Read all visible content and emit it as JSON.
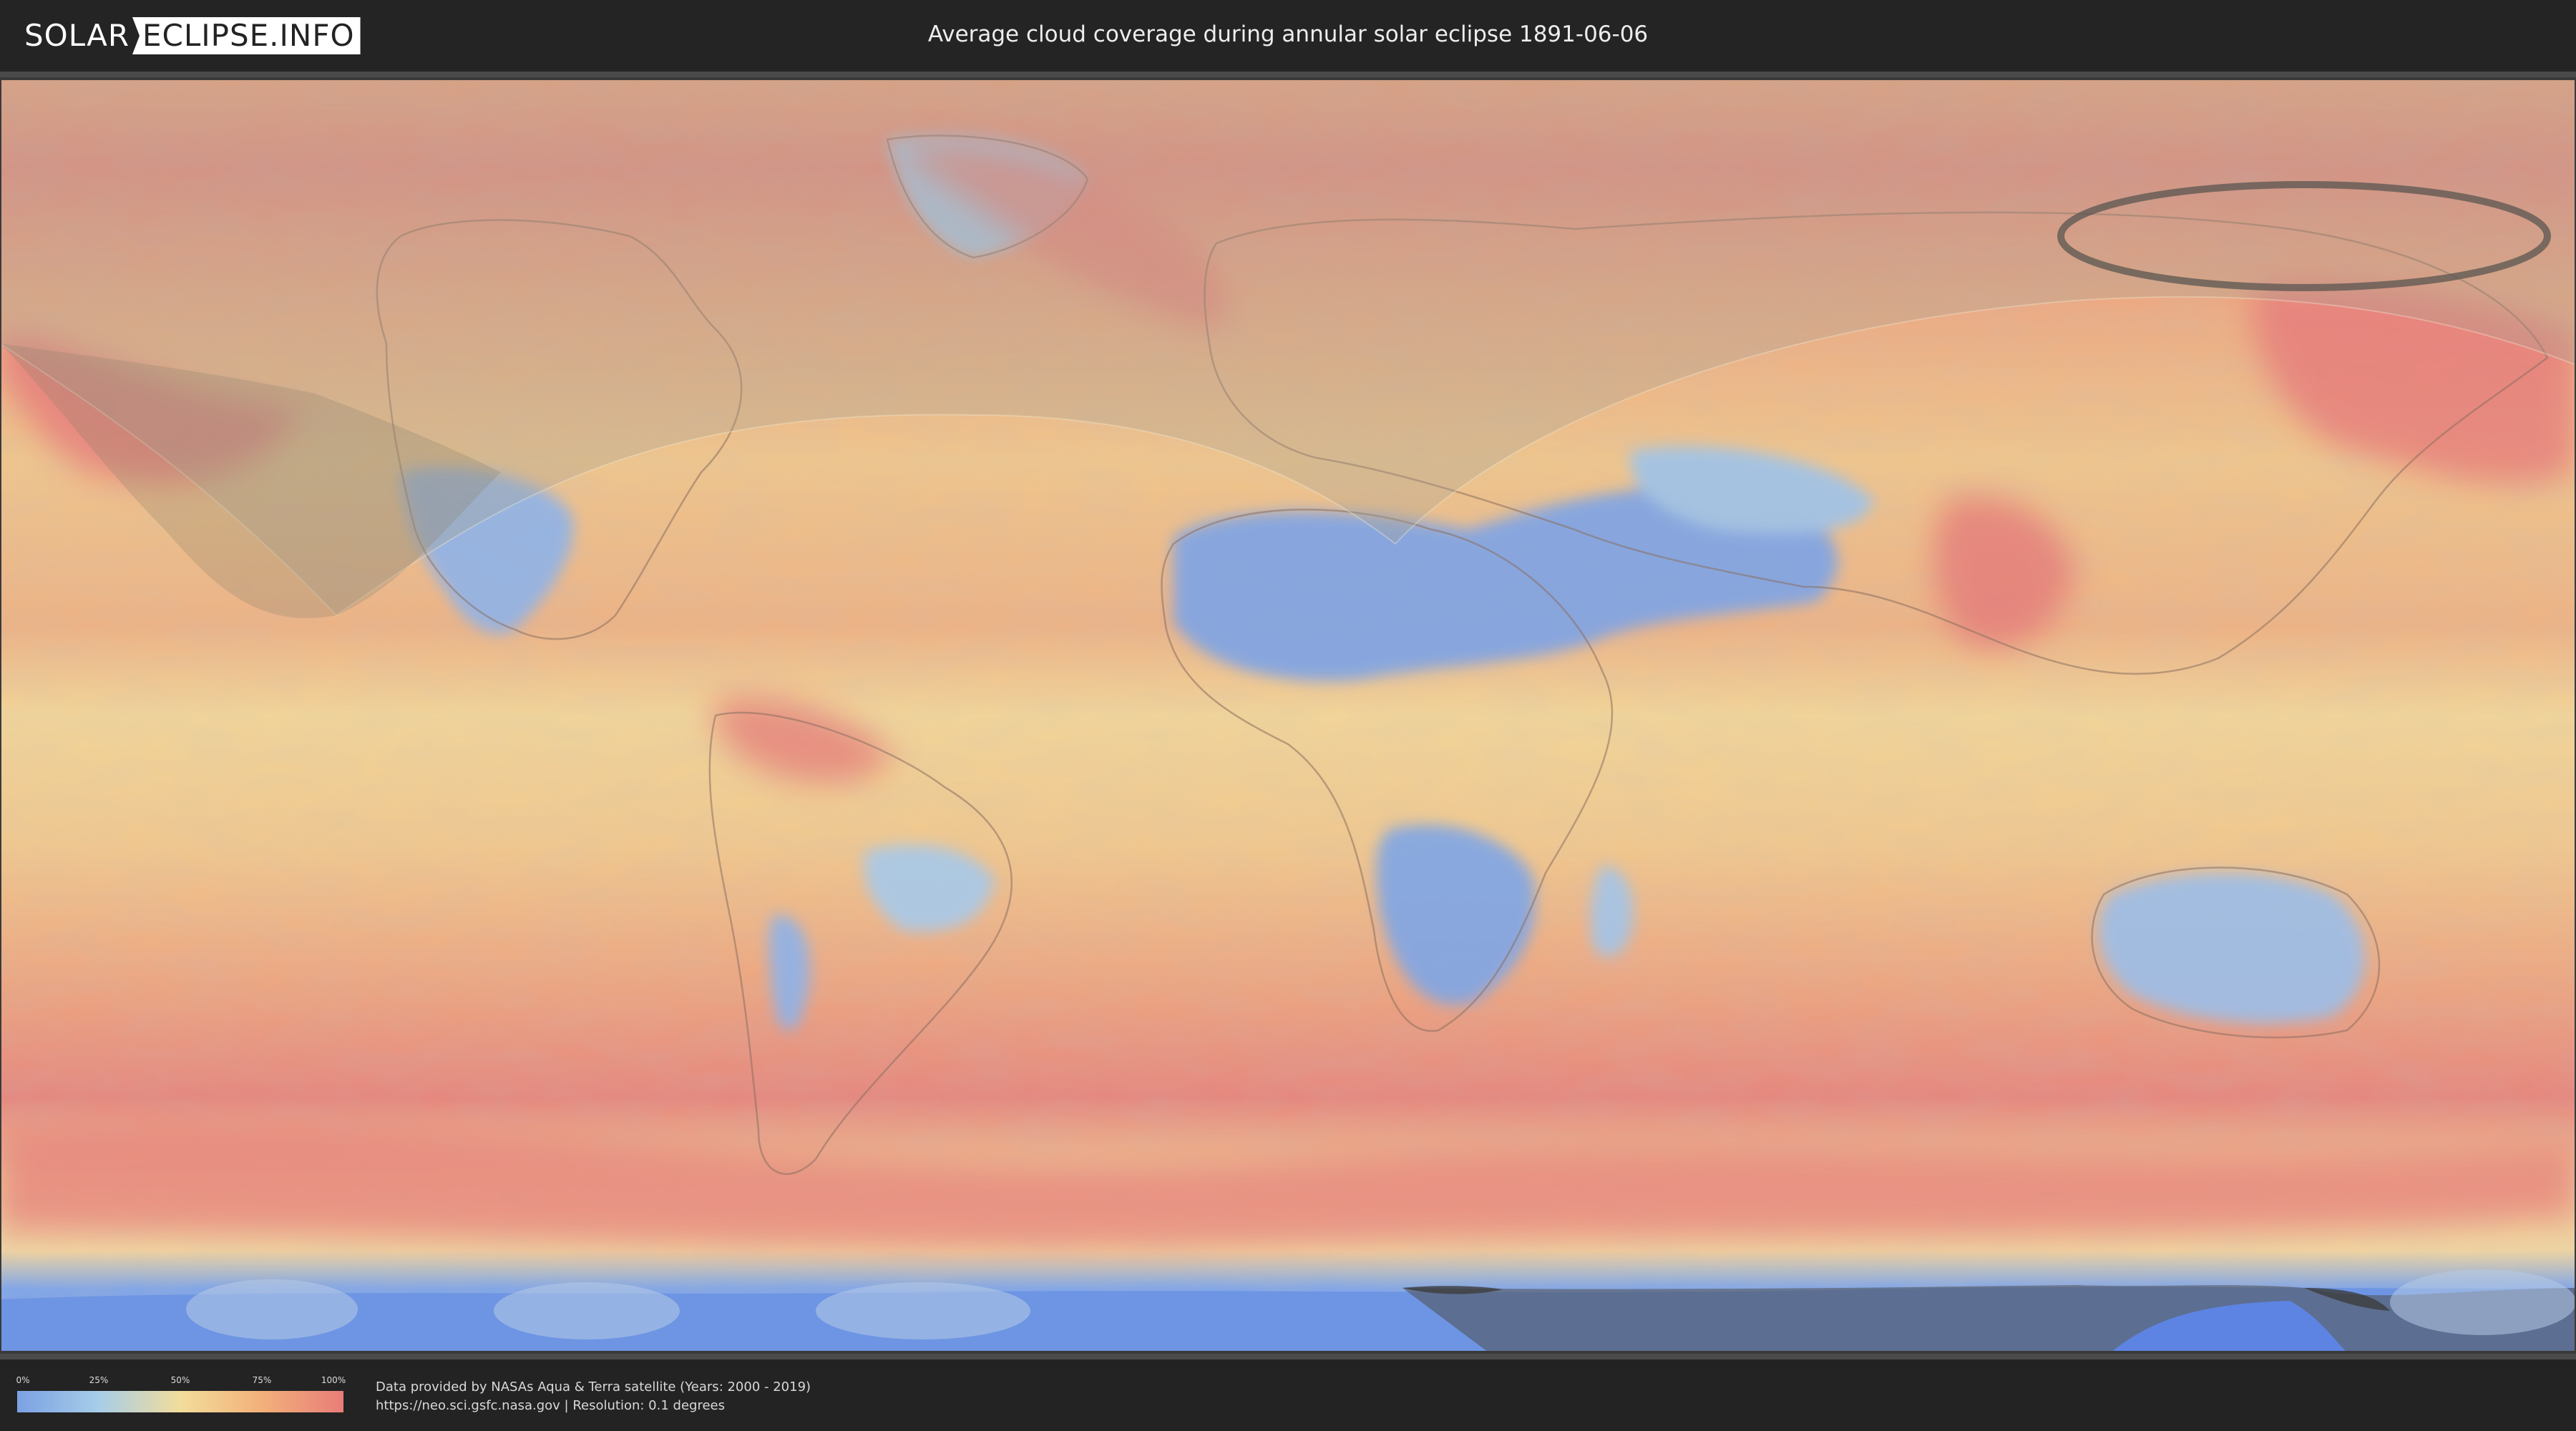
{
  "header": {
    "logo_left": "SOLAR",
    "logo_right": "ECLIPSE.INFO",
    "title": "Average cloud coverage during annular solar eclipse 1891-06-06"
  },
  "map": {
    "kind": "world cloud-coverage map",
    "palette": {
      "clear": "#7ba1e4",
      "low": "#a7cde8",
      "mid": "#f2dd9b",
      "high": "#f2b07a",
      "overcast": "#e87d78"
    },
    "overlay_color": "#a8a392",
    "path_line_color": "#5a5650"
  },
  "legend": {
    "ticks": [
      "0%",
      "25%",
      "50%",
      "75%",
      "100%"
    ]
  },
  "credits": {
    "line1": "Data provided by NASAs Aqua & Terra satellite (Years: 2000 - 2019)",
    "line2": "https://neo.sci.gsfc.nasa.gov | Resolution: 0.1 degrees"
  }
}
